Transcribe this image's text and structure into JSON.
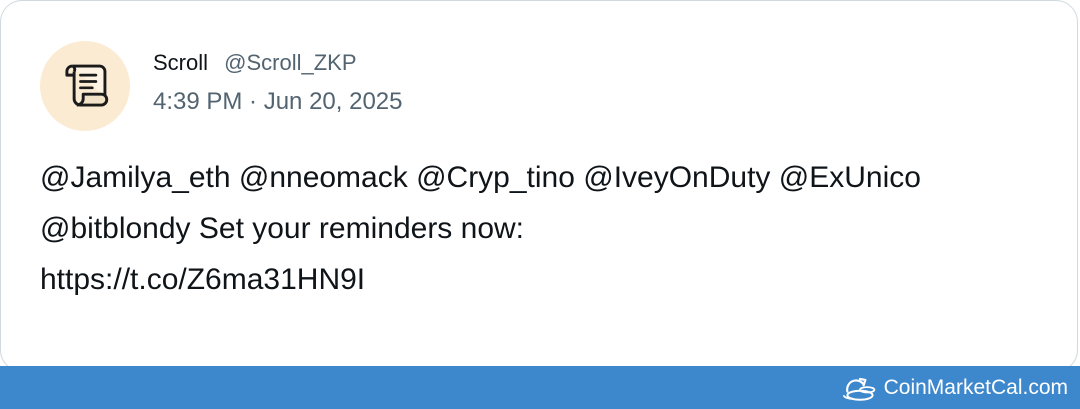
{
  "tweet": {
    "display_name": "Scroll",
    "handle": "@Scroll_ZKP",
    "timestamp": "4:39 PM · Jun 20, 2025",
    "avatar_icon": "scroll-icon",
    "text_lines": [
      "@Jamilya_eth @nneomack @Cryp_tino @IveyOnDuty @ExUnico",
      "@bitblondy Set your reminders now:",
      "https://t.co/Z6ma31HN9I"
    ]
  },
  "footer": {
    "brand_label": "CoinMarketCal.com",
    "brand_icon": "coinmarketcal-logo-icon",
    "background_color": "#3d87cc"
  },
  "colors": {
    "avatar_bg": "#fcebd3",
    "text_primary": "#0f1419",
    "text_secondary": "#536471"
  }
}
